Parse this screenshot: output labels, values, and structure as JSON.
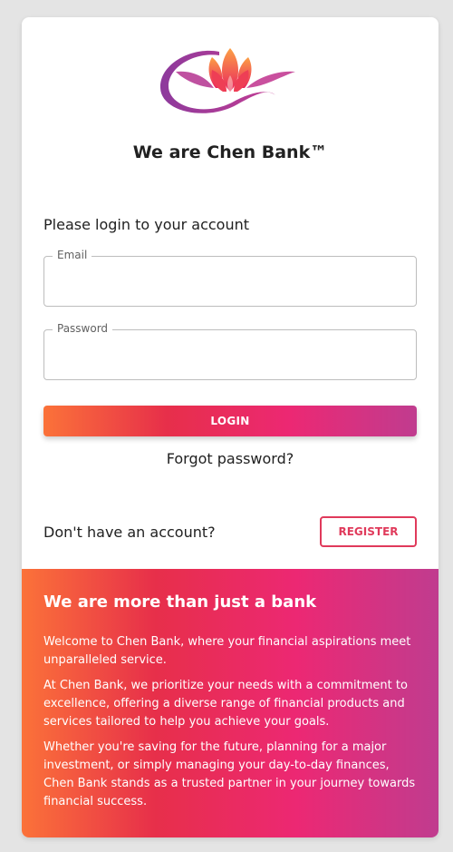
{
  "brand": {
    "logo": "lotus-logo",
    "title": "We are Chen Bank™"
  },
  "login": {
    "prompt": "Please login to your account",
    "email_label": "Email",
    "email_value": "",
    "password_label": "Password",
    "password_value": "",
    "login_button": "LOGIN",
    "forgot_password": "Forgot password?"
  },
  "register": {
    "prompt": "Don't have an account?",
    "button": "REGISTER"
  },
  "promo": {
    "heading": "We are more than just a bank",
    "paragraphs": [
      "Welcome to Chen Bank, where your financial aspirations meet unparalleled service.",
      "At Chen Bank, we prioritize your needs with a commitment to excellence, offering a diverse range of financial products and services tailored to help you achieve your goals.",
      "Whether you're saving for the future, planning for a major investment, or simply managing your day-to-day finances, Chen Bank stands as a trusted partner in your journey towards financial success."
    ]
  },
  "colors": {
    "gradient": [
      "#fb7239",
      "#e72f4a",
      "#ec2873",
      "#c03c8f"
    ],
    "register_accent": "#e03a5b",
    "page_background": "#e4e4e4"
  }
}
